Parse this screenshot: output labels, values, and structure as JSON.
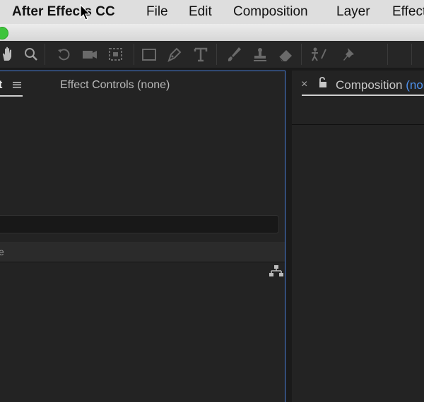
{
  "menubar": {
    "app_name": "After Effects CC",
    "items": [
      "File",
      "Edit",
      "Composition",
      "Layer",
      "Effect"
    ]
  },
  "toolbar": {
    "tools": [
      "hand-icon",
      "zoom-icon",
      "rotate-icon",
      "camera-icon",
      "pan-behind-icon",
      "rectangle-icon",
      "pen-icon",
      "type-icon",
      "brush-icon",
      "clone-stamp-icon",
      "eraser-icon",
      "puppet-icon",
      "pin-icon"
    ]
  },
  "left_panel": {
    "project_tab": "t",
    "effect_controls_tab": "Effect Controls (none)",
    "column_header": "e"
  },
  "right_panel": {
    "close_glyph": "×",
    "composition_tab": "Composition",
    "composition_tab_accent": "(none"
  },
  "colors": {
    "accent_blue": "#4f92ee",
    "panel_focus_border": "#4a7fd8",
    "window_green": "#3ec43c"
  }
}
